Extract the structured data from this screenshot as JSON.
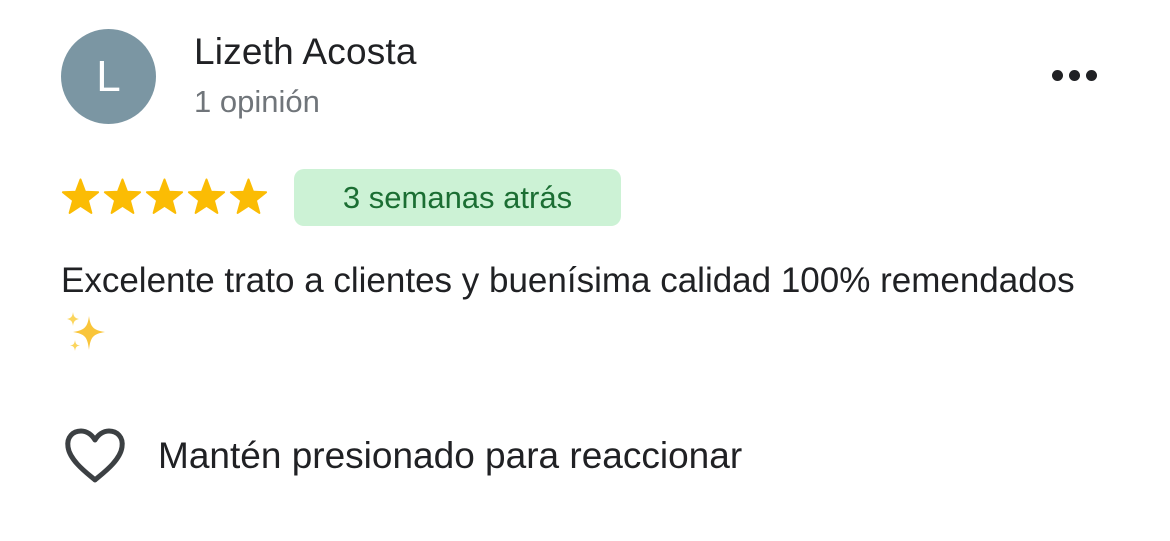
{
  "review": {
    "author": {
      "initial": "L",
      "name": "Lizeth Acosta",
      "meta": "1 opinión",
      "avatar_color": "#7b96a3"
    },
    "more_icon": "more-horizontal-icon",
    "rating": 5,
    "rating_max": 5,
    "star_color": "#fbbc04",
    "date": "3 semanas atrás",
    "date_badge_bg": "#ccf2d5",
    "date_badge_color": "#1b6e33",
    "text": "Excelente trato a clientes y buenísima calidad 100% remendados",
    "text_emoji": "sparkles-icon",
    "reaction": {
      "icon": "heart-outline-icon",
      "label": "Mantén presionado para reaccionar"
    }
  }
}
